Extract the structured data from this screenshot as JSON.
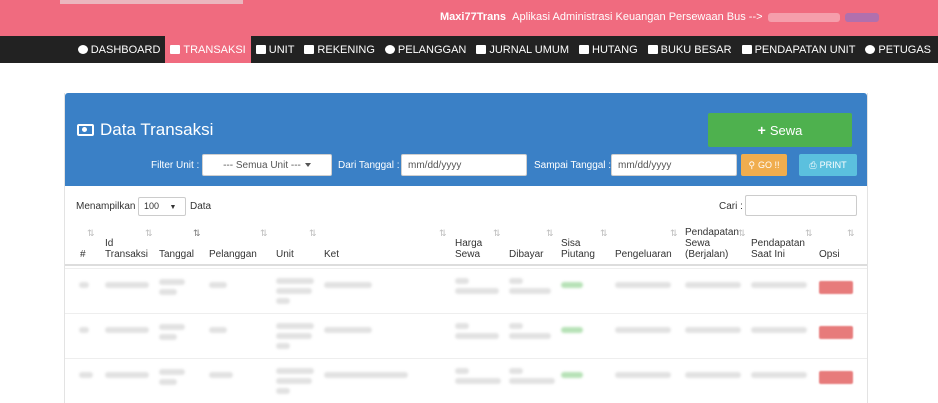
{
  "header": {
    "app_name": "Maxi77Trans",
    "tagline": "Aplikasi Administrasi Keuangan Persewaan Bus -->"
  },
  "nav": [
    {
      "label": "DASHBOARD",
      "icon": "dashboard-icon",
      "active": false
    },
    {
      "label": "TRANSAKSI",
      "icon": "money-icon",
      "active": true
    },
    {
      "label": "UNIT",
      "icon": "bus-icon",
      "active": false
    },
    {
      "label": "REKENING",
      "icon": "tag-icon",
      "active": false
    },
    {
      "label": "PELANGGAN",
      "icon": "users-icon",
      "active": false
    },
    {
      "label": "JURNAL UMUM",
      "icon": "book-icon",
      "active": false
    },
    {
      "label": "HUTANG",
      "icon": "credit-card-icon",
      "active": false
    },
    {
      "label": "BUKU BESAR",
      "icon": "ledger-icon",
      "active": false
    },
    {
      "label": "PENDAPATAN UNIT",
      "icon": "bar-chart-icon",
      "active": false
    },
    {
      "label": "PETUGAS",
      "icon": "user-icon",
      "active": false
    }
  ],
  "panel": {
    "title": "Data Transaksi",
    "add_button": "Sewa",
    "filter_unit_label": "Filter Unit :",
    "filter_unit_value": "--- Semua Unit ---",
    "from_label": "Dari Tanggal :",
    "from_placeholder": "mm/dd/yyyy",
    "to_label": "Sampai Tanggal :",
    "to_placeholder": "mm/dd/yyyy",
    "go_button": "GO !!",
    "print_button": "PRINT"
  },
  "table_controls": {
    "show_label": "Menampilkan",
    "page_size": "100",
    "show_suffix": "Data",
    "search_label": "Cari :"
  },
  "columns": [
    {
      "line1": "#",
      "line2": ""
    },
    {
      "line1": "Id",
      "line2": "Transaksi"
    },
    {
      "line1": "Tanggal",
      "line2": ""
    },
    {
      "line1": "Pelanggan",
      "line2": ""
    },
    {
      "line1": "Unit",
      "line2": ""
    },
    {
      "line1": "Ket",
      "line2": ""
    },
    {
      "line1": "Harga",
      "line2": "Sewa"
    },
    {
      "line1": "Dibayar",
      "line2": ""
    },
    {
      "line1": "Sisa",
      "line2": "Piutang"
    },
    {
      "line1": "Pengeluaran",
      "line2": ""
    },
    {
      "line1": "Pendapatan",
      "line2": "Sewa"
    },
    {
      "line1": "Pendapatan",
      "line2": "Saat Ini"
    },
    {
      "line1": "Opsi",
      "line2": ""
    }
  ],
  "column_extra": {
    "pendapatan_sewa_line3": "(Berjalan)"
  },
  "colors": {
    "accent": "#f06b7f",
    "navbar": "#222222",
    "panel_header": "#3a80c6",
    "add_button": "#4eb14e",
    "go_button": "#f0ad4e",
    "print_button": "#5bc0de"
  }
}
